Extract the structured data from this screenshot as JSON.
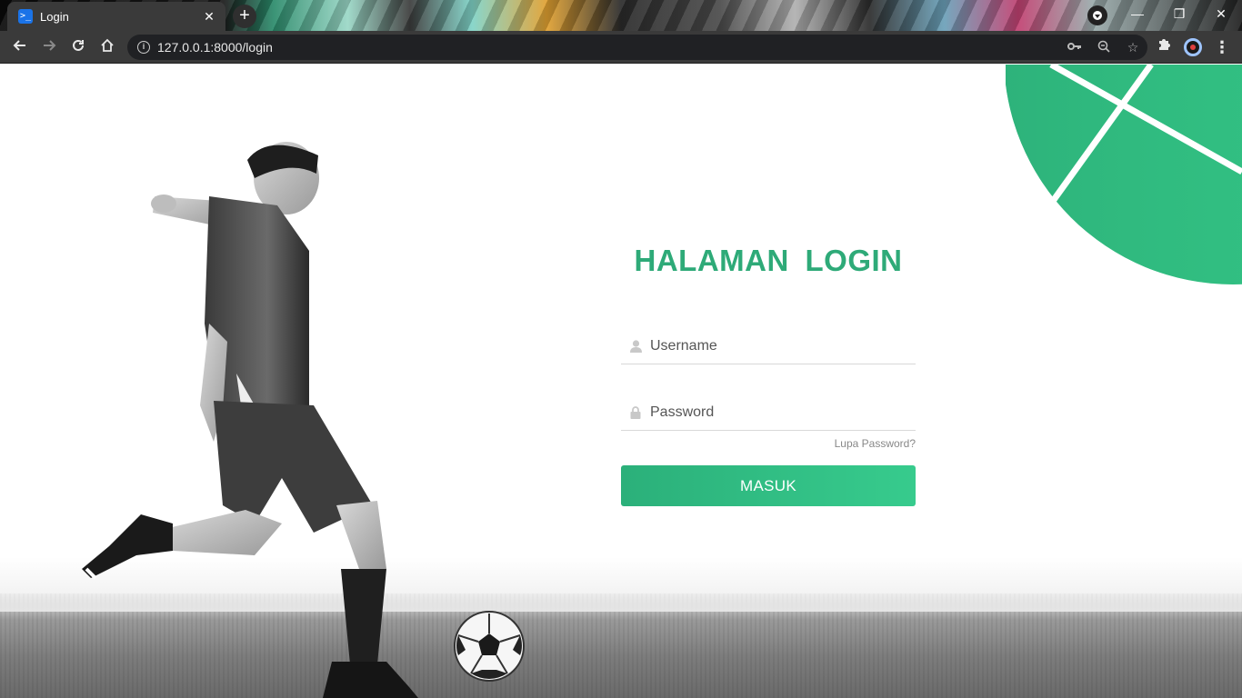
{
  "browser": {
    "tab_title": "Login",
    "tab_favicon": ">_",
    "tab_close": "✕",
    "new_tab": "+",
    "url": "127.0.0.1:8000/login",
    "window_controls": {
      "minimize": "—",
      "maximize": "❐",
      "close": "✕"
    }
  },
  "login": {
    "title": "HALAMAN  LOGIN",
    "username_placeholder": "Username",
    "password_placeholder": "Password",
    "forgot_link": "Lupa Password?",
    "submit_label": "MASUK"
  },
  "colors": {
    "accent": "#2eaa78",
    "button_start": "#2bb07a",
    "button_end": "#37cb8d",
    "deco": "#32c283"
  },
  "icons": {
    "username": "user-icon",
    "password": "lock-icon",
    "back": "arrow-left-icon",
    "forward": "arrow-right-icon",
    "reload": "reload-icon",
    "home": "home-icon",
    "site_info": "info-icon",
    "password_key": "key-icon",
    "zoom": "zoom-out-icon",
    "bookmark": "star-icon",
    "extensions": "puzzle-icon",
    "menu": "kebab-menu-icon"
  }
}
